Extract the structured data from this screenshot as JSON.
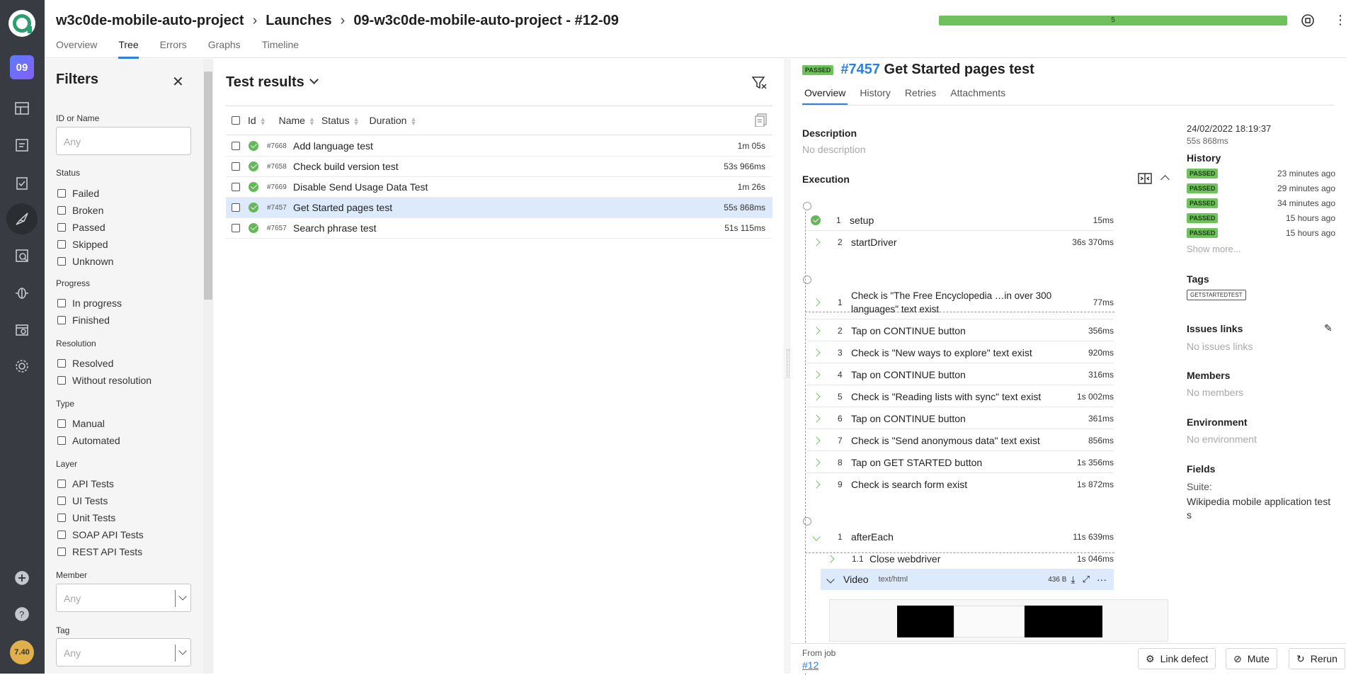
{
  "rail": {
    "launch_number": "09",
    "avatar_text": "7.40",
    "icons": [
      "dashboard-icon",
      "report-icon",
      "checklist-icon",
      "launches-icon",
      "search-analysis-icon",
      "bug-icon",
      "settings-icon",
      "plus-icon",
      "help-icon"
    ]
  },
  "header": {
    "breadcrumbs": [
      "w3c0de-mobile-auto-project",
      "Launches",
      "09-w3c0de-mobile-auto-project - #12-09"
    ],
    "tabs": [
      "Overview",
      "Tree",
      "Errors",
      "Graphs",
      "Timeline"
    ],
    "active_tab": "Tree",
    "progress_label": "5"
  },
  "filters": {
    "title": "Filters",
    "id_label": "ID or Name",
    "id_placeholder": "Any",
    "status_label": "Status",
    "status": [
      "Failed",
      "Broken",
      "Passed",
      "Skipped",
      "Unknown"
    ],
    "progress_label": "Progress",
    "progress": [
      "In progress",
      "Finished"
    ],
    "resolution_label": "Resolution",
    "resolution": [
      "Resolved",
      "Without resolution"
    ],
    "type_label": "Type",
    "type": [
      "Manual",
      "Automated"
    ],
    "layer_label": "Layer",
    "layer": [
      "API Tests",
      "UI Tests",
      "Unit Tests",
      "SOAP API Tests",
      "REST API Tests"
    ],
    "member_label": "Member",
    "member_placeholder": "Any",
    "tag_label": "Tag",
    "tag_placeholder": "Any"
  },
  "results": {
    "title": "Test results",
    "columns": [
      "Id",
      "Name",
      "Status",
      "Duration"
    ],
    "rows": [
      {
        "id": "#7668",
        "name": "Add language test",
        "duration": "1m 05s"
      },
      {
        "id": "#7658",
        "name": "Check build version test",
        "duration": "53s 966ms"
      },
      {
        "id": "#7669",
        "name": "Disable Send Usage Data Test",
        "duration": "1m 26s"
      },
      {
        "id": "#7457",
        "name": "Get Started pages test",
        "duration": "55s 868ms"
      },
      {
        "id": "#7657",
        "name": "Search phrase test",
        "duration": "51s 115ms"
      }
    ]
  },
  "details": {
    "status": "PASSED",
    "number": "#7457",
    "title": "Get Started pages test",
    "tabs": [
      "Overview",
      "History",
      "Retries",
      "Attachments"
    ],
    "description_label": "Description",
    "description": "No description",
    "execution_label": "Execution",
    "setup_steps": [
      {
        "n": "1",
        "text": "setup",
        "dur": "15ms"
      },
      {
        "n": "2",
        "text": "startDriver",
        "dur": "36s 370ms"
      }
    ],
    "body_steps": [
      {
        "n": "1",
        "text": "Check is \"The Free Encyclopedia …in over 300 languages\" text exist",
        "dur": "77ms"
      },
      {
        "n": "2",
        "text": "Tap on CONTINUE button",
        "dur": "356ms"
      },
      {
        "n": "3",
        "text": "Check is \"New ways to explore\" text exist",
        "dur": "920ms"
      },
      {
        "n": "4",
        "text": "Tap on CONTINUE button",
        "dur": "316ms"
      },
      {
        "n": "5",
        "text": "Check is \"Reading lists with sync\" text exist",
        "dur": "1s 002ms"
      },
      {
        "n": "6",
        "text": "Tap on CONTINUE button",
        "dur": "361ms"
      },
      {
        "n": "7",
        "text": "Check is \"Send anonymous data\" text exist",
        "dur": "856ms"
      },
      {
        "n": "8",
        "text": "Tap on GET STARTED button",
        "dur": "1s 356ms"
      },
      {
        "n": "9",
        "text": "Check is search form exist",
        "dur": "1s 872ms"
      }
    ],
    "teardown_step": {
      "n": "1",
      "text": "afterEach",
      "dur": "11s 639ms"
    },
    "teardown_sub": {
      "n": "1.1",
      "text": "Close webdriver",
      "dur": "1s 046ms"
    },
    "video": {
      "name": "Video",
      "type": "text/html",
      "size": "436 B"
    },
    "side": {
      "date": "24/02/2022 18:19:37",
      "duration": "55s 868ms",
      "history_label": "History",
      "history": [
        {
          "status": "PASSED",
          "ago": "23 minutes ago"
        },
        {
          "status": "PASSED",
          "ago": "29 minutes ago"
        },
        {
          "status": "PASSED",
          "ago": "34 minutes ago"
        },
        {
          "status": "PASSED",
          "ago": "15 hours ago"
        },
        {
          "status": "PASSED",
          "ago": "15 hours ago"
        }
      ],
      "show_more": "Show more...",
      "tags_label": "Tags",
      "tag": "GETSTARTEDTEST",
      "issues_label": "Issues links",
      "issues": "No issues links",
      "members_label": "Members",
      "members": "No members",
      "env_label": "Environment",
      "env": "No environment",
      "fields_label": "Fields",
      "suite_label": "Suite:",
      "suite": "Wikipedia mobile application tests"
    },
    "from_job_label": "From job",
    "from_job": "#12",
    "buttons": {
      "link_defect": "Link defect",
      "mute": "Mute",
      "rerun": "Rerun"
    }
  },
  "colors": {
    "passed": "#6fc25b",
    "accent": "#2d7fe0",
    "rail": "#383c42",
    "selected_row": "#ddeafb"
  }
}
